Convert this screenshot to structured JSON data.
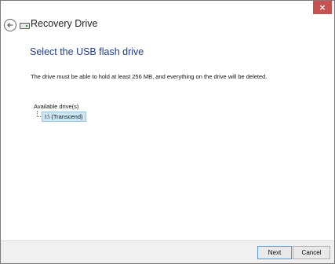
{
  "window": {
    "title": "Recovery Drive",
    "close_label": "×"
  },
  "main": {
    "heading": "Select the USB flash drive",
    "description": "The drive must be able to hold at least 256 MB, and everything on the drive will be deleted.",
    "available_label": "Available drive(s)",
    "drives": [
      {
        "label": "I:\\ (Transcend)",
        "selected": true
      }
    ]
  },
  "footer": {
    "next_label": "Next",
    "cancel_label": "Cancel"
  },
  "colors": {
    "heading": "#1e3c8c",
    "close_button": "#c75050",
    "selection": "#cce8f7"
  },
  "icons": {
    "back": "back-arrow-icon",
    "drive": "drive-icon"
  }
}
